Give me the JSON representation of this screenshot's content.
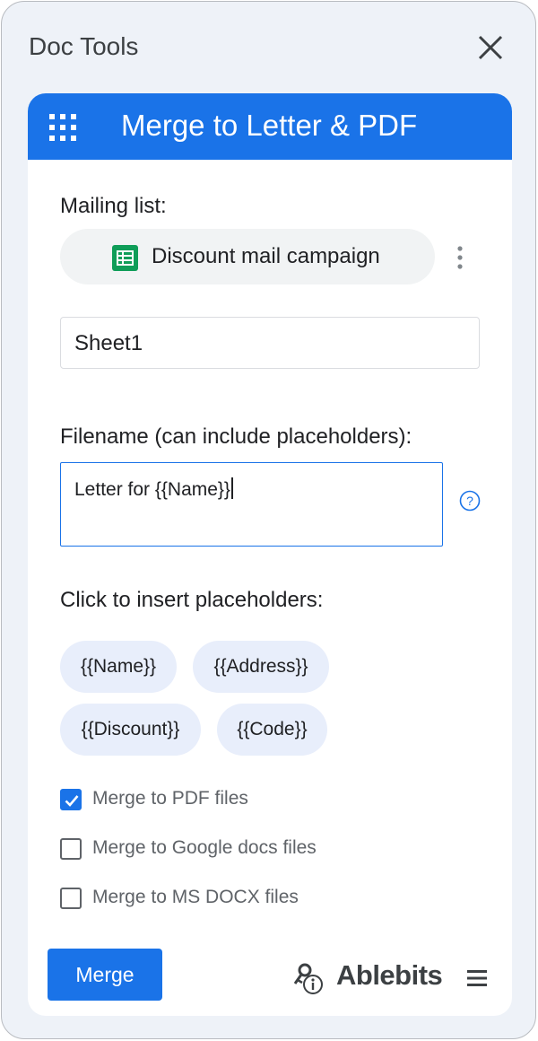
{
  "window": {
    "title": "Doc Tools"
  },
  "icons": {
    "close": "close-icon",
    "grid": "grid-icon",
    "sheets": "google-sheets-icon",
    "more": "more-vert-icon",
    "help": "help-icon",
    "ablebits": "ablebits-key-info-icon",
    "menu": "hamburger-menu-icon"
  },
  "colors": {
    "accent": "#1a73e8",
    "sheets_green": "#0f9d58",
    "chip_bg": "#e8eefb",
    "panel_bg": "#eef2f8"
  },
  "header": {
    "title": "Merge to Letter & PDF"
  },
  "mailing": {
    "label": "Mailing list:",
    "spreadsheet": "Discount mail campaign",
    "sheet": "Sheet1"
  },
  "filename": {
    "label": "Filename (can include placeholders):",
    "value": "Letter for {{Name}}"
  },
  "placeholders": {
    "label": "Click to insert placeholders:",
    "chips": [
      "{{Name}}",
      "{{Address}}",
      "{{Discount}}",
      "{{Code}}"
    ]
  },
  "options": [
    {
      "label": "Merge to PDF files",
      "checked": true
    },
    {
      "label": "Merge to Google docs files",
      "checked": false
    },
    {
      "label": "Merge to MS DOCX files",
      "checked": false
    }
  ],
  "footer": {
    "merge_label": "Merge",
    "brand": "Ablebits"
  }
}
